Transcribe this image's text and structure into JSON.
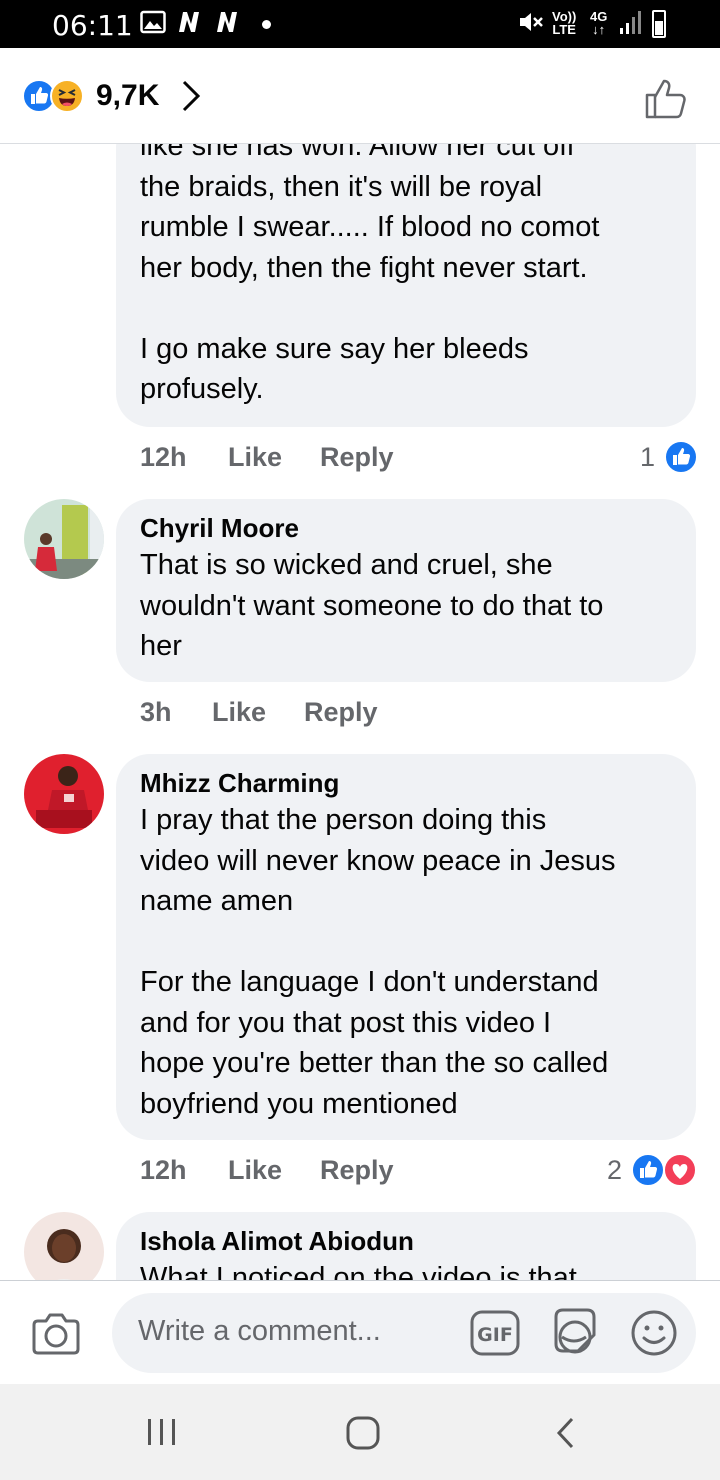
{
  "status_bar": {
    "time": "06:11",
    "volte_top": "Vo))",
    "volte_bottom": "LTE",
    "network_top": "4G",
    "network_bottom": "↓↑",
    "icons": [
      "gallery-icon",
      "n-notification-icon",
      "n-notification-icon",
      "dot-icon",
      "mute-icon",
      "signal-icon",
      "battery-icon"
    ]
  },
  "header": {
    "reactions": [
      "like-reaction",
      "haha-reaction"
    ],
    "reaction_count": "9,7K",
    "icons": [
      "chevron-right-icon",
      "thumbs-up-outline-icon"
    ]
  },
  "comments": [
    {
      "author": "",
      "text_lines": "like she has won.  Allow her cut off\nthe braids, then it's will be royal\nrumble I swear..... If blood no comot\nher body, then the fight never start.\n\nI go make sure say her bleeds\nprofusely.",
      "time": "12h",
      "like_label": "Like",
      "reply_label": "Reply",
      "reaction_count": "1",
      "reactions": [
        "like-reaction"
      ]
    },
    {
      "author": "Chyril Moore",
      "text_lines": "That is so wicked and cruel, she\nwouldn't want someone to do that to\nher",
      "time": "3h",
      "like_label": "Like",
      "reply_label": "Reply"
    },
    {
      "author": "Mhizz Charming",
      "text_lines": "I pray that the person doing this\nvideo will never know peace in Jesus\nname amen\n\nFor the language I don't understand\nand for you that post this video I\nhope you're better than the so called\nboyfriend you mentioned",
      "time": "12h",
      "like_label": "Like",
      "reply_label": "Reply",
      "reaction_count": "2",
      "reactions": [
        "like-reaction",
        "love-reaction"
      ]
    },
    {
      "author": "Ishola Alimot Abiodun",
      "text_lines": "What I noticed on the video is that"
    }
  ],
  "composer": {
    "placeholder": "Write a comment...",
    "icons": [
      "camera-icon",
      "gif-icon",
      "sticker-icon",
      "emoji-icon"
    ]
  },
  "nav_bar": {
    "icons": [
      "recents-icon",
      "home-icon",
      "back-icon"
    ]
  },
  "colors": {
    "facebook_blue": "#1877f2",
    "love_red": "#f33e58",
    "bubble_bg": "#f0f2f5",
    "meta_gray": "#65676b"
  }
}
